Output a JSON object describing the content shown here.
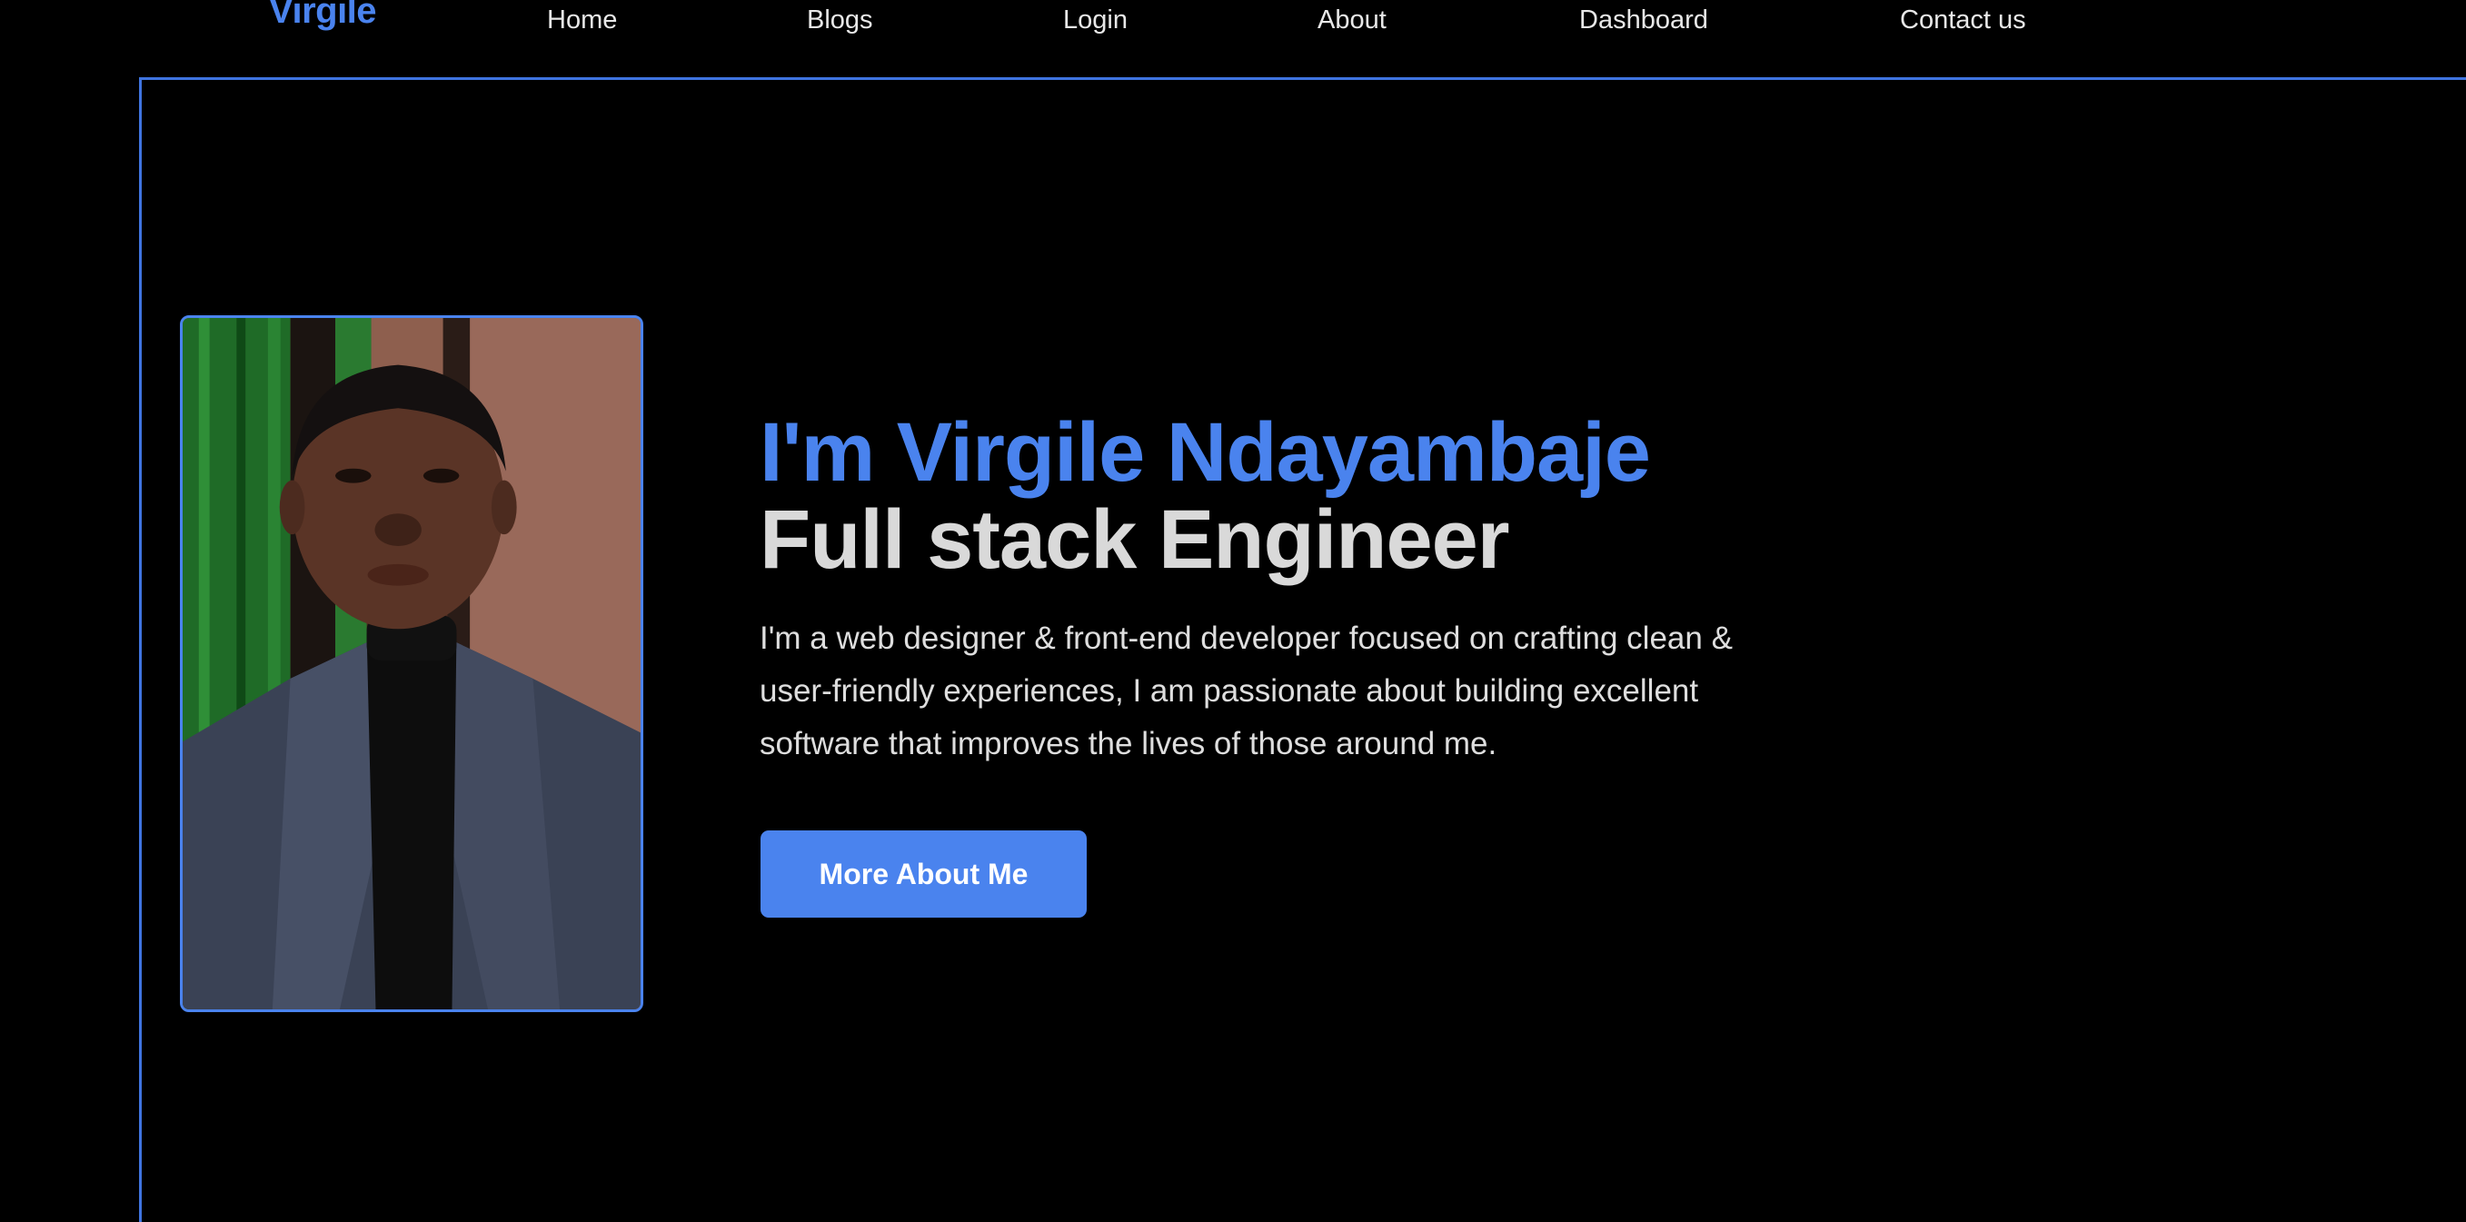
{
  "nav": {
    "logo": "Virgile",
    "links": [
      {
        "label": "Home"
      },
      {
        "label": "Blogs"
      },
      {
        "label": "Login"
      },
      {
        "label": "About"
      },
      {
        "label": "Dashboard"
      },
      {
        "label": "Contact us"
      }
    ]
  },
  "hero": {
    "name": "I'm Virgile Ndayambaje",
    "role": "Full stack Engineer",
    "description": "I'm a web designer & front-end developer focused on crafting clean & user-friendly experiences, I am passionate about building excellent software that improves the lives of those around me.",
    "cta_label": "More About Me",
    "portrait_icon": "profile-photo"
  },
  "colors": {
    "accent": "#4a83ee",
    "background": "#000000",
    "text": "#e6e6e6"
  }
}
